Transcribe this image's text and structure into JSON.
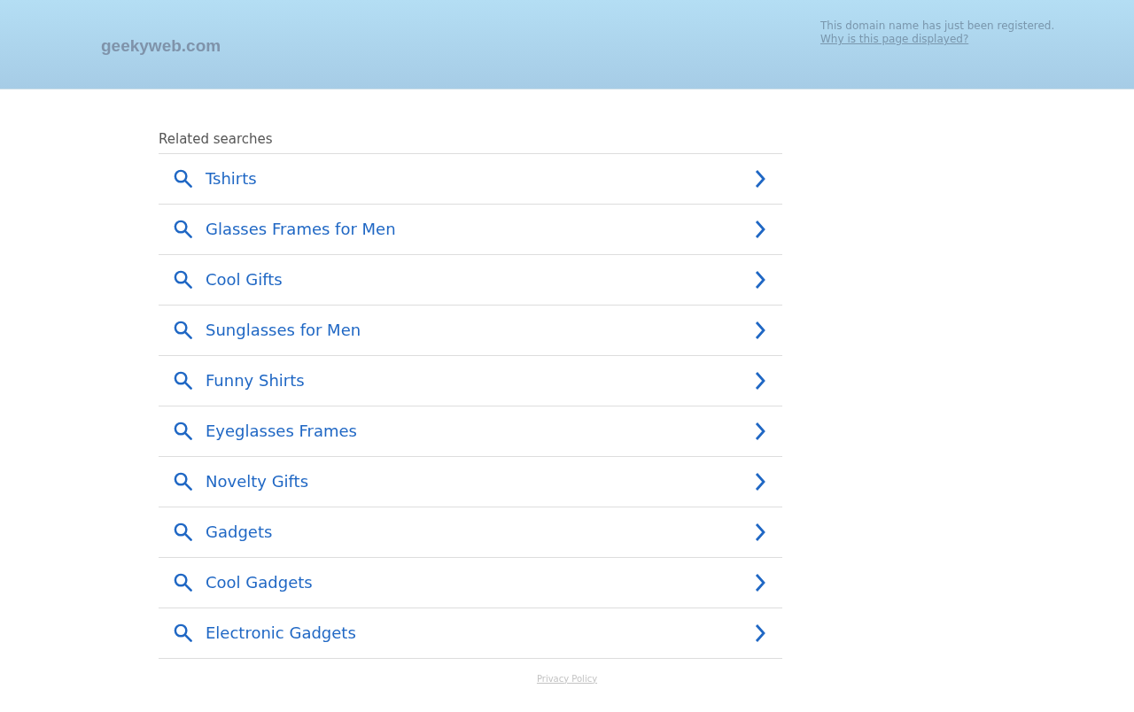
{
  "header": {
    "logo": "geekyweb.com",
    "notice": "This domain name has just been registered.",
    "notice_link": "Why is this page displayed?"
  },
  "related": {
    "title": "Related searches",
    "items": [
      {
        "label": "Tshirts"
      },
      {
        "label": "Glasses Frames for Men"
      },
      {
        "label": "Cool Gifts"
      },
      {
        "label": "Sunglasses for Men"
      },
      {
        "label": "Funny Shirts"
      },
      {
        "label": "Eyeglasses Frames"
      },
      {
        "label": "Novelty Gifts"
      },
      {
        "label": "Gadgets"
      },
      {
        "label": "Cool Gadgets"
      },
      {
        "label": "Electronic Gadgets"
      }
    ]
  },
  "footer": {
    "privacy_link": "Privacy Policy"
  }
}
